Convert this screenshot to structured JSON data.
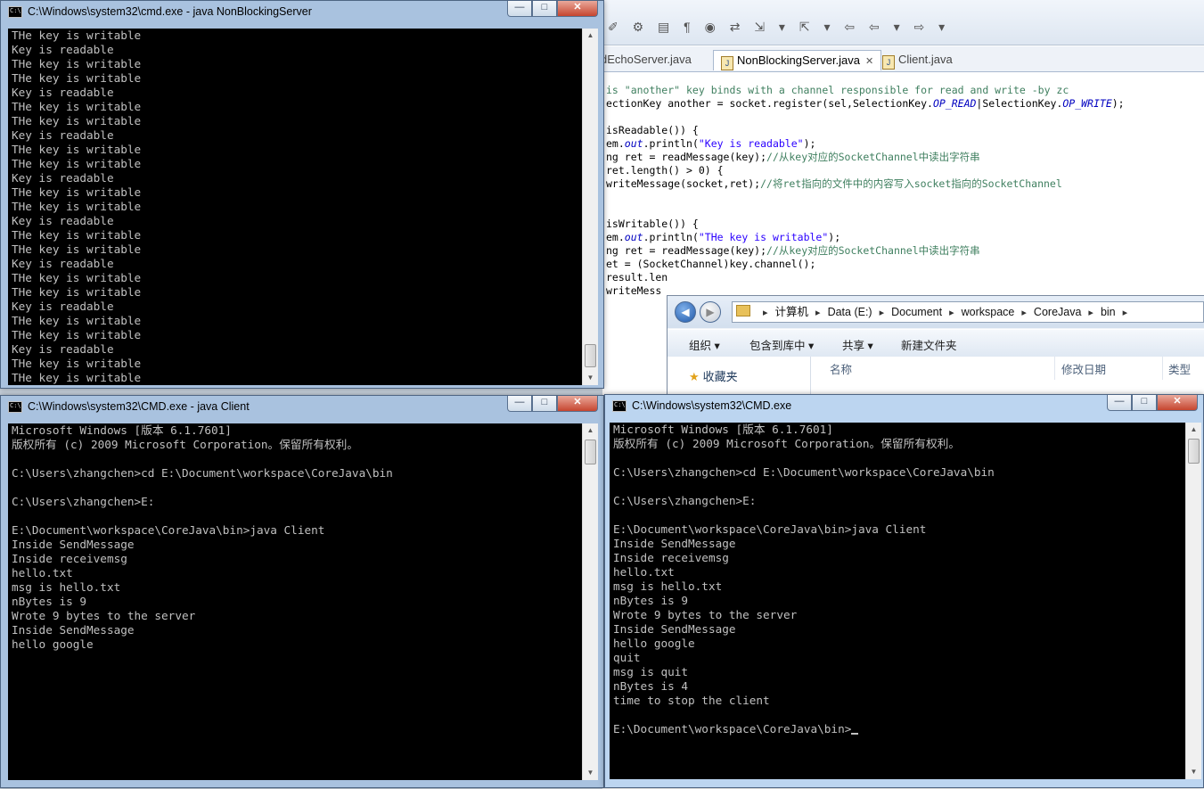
{
  "eclipse": {
    "tabs": [
      {
        "label": "dEchoServer.java"
      },
      {
        "label": "NonBlockingServer.java"
      },
      {
        "label": "Client.java"
      }
    ],
    "code_lines": [
      [
        {
          "t": "is \"another\" key binds with a channel responsible for read and write -by zc",
          "c": "cmt"
        }
      ],
      [
        {
          "t": "ectionKey another = socket.register(sel,SelectionKey.",
          "c": ""
        },
        {
          "t": "OP_READ",
          "c": "fld"
        },
        {
          "t": "|SelectionKey.",
          "c": ""
        },
        {
          "t": "OP_WRITE",
          "c": "fld"
        },
        {
          "t": ");",
          "c": ""
        }
      ],
      [
        {
          "t": "",
          "c": ""
        }
      ],
      [
        {
          "t": "isReadable()) {",
          "c": ""
        }
      ],
      [
        {
          "t": "em.",
          "c": ""
        },
        {
          "t": "out",
          "c": "fld"
        },
        {
          "t": ".println(",
          "c": ""
        },
        {
          "t": "\"Key is readable\"",
          "c": "str"
        },
        {
          "t": ");",
          "c": ""
        }
      ],
      [
        {
          "t": "ng ret = readMessage(key);",
          "c": ""
        },
        {
          "t": "//从key对应的SocketChannel中读出字符串",
          "c": "cmt"
        }
      ],
      [
        {
          "t": "ret.length() > 0) {",
          "c": ""
        }
      ],
      [
        {
          "t": "writeMessage(socket,ret);",
          "c": ""
        },
        {
          "t": "//将ret指向的文件中的内容写入socket指向的SocketChannel",
          "c": "cmt"
        }
      ],
      [
        {
          "t": "",
          "c": ""
        }
      ],
      [
        {
          "t": "",
          "c": ""
        }
      ],
      [
        {
          "t": "isWritable()) {",
          "c": ""
        }
      ],
      [
        {
          "t": "em.",
          "c": ""
        },
        {
          "t": "out",
          "c": "fld"
        },
        {
          "t": ".println(",
          "c": ""
        },
        {
          "t": "\"THe key is writable\"",
          "c": "str"
        },
        {
          "t": ");",
          "c": ""
        }
      ],
      [
        {
          "t": "ng ret = readMessage(key);",
          "c": ""
        },
        {
          "t": "//从key对应的SocketChannel中读出字符串",
          "c": "cmt"
        }
      ],
      [
        {
          "t": "et = (SocketChannel)key.channel();",
          "c": ""
        }
      ],
      [
        {
          "t": "result.len",
          "c": ""
        }
      ],
      [
        {
          "t": "writeMess",
          "c": ""
        }
      ]
    ]
  },
  "explorer": {
    "breadcrumb": [
      "计算机",
      "Data (E:)",
      "Document",
      "workspace",
      "CoreJava",
      "bin"
    ],
    "toolbar": [
      "组织 ▾",
      "包含到库中 ▾",
      "共享 ▾",
      "新建文件夹"
    ],
    "nav_favorites": "收藏夹",
    "columns": [
      "名称",
      "修改日期",
      "类型"
    ]
  },
  "server_window": {
    "title": "C:\\Windows\\system32\\cmd.exe - java  NonBlockingServer",
    "lines": [
      "THe key is writable",
      "Key is readable",
      "THe key is writable",
      "THe key is writable",
      "Key is readable",
      "THe key is writable",
      "THe key is writable",
      "Key is readable",
      "THe key is writable",
      "THe key is writable",
      "Key is readable",
      "THe key is writable",
      "THe key is writable",
      "Key is readable",
      "THe key is writable",
      "THe key is writable",
      "Key is readable",
      "THe key is writable",
      "THe key is writable",
      "Key is readable",
      "THe key is writable",
      "THe key is writable",
      "Key is readable",
      "THe key is writable",
      "THe key is writable"
    ]
  },
  "client1_window": {
    "title": "C:\\Windows\\system32\\CMD.exe - java  Client",
    "lines": [
      "Microsoft Windows [版本 6.1.7601]",
      "版权所有 (c) 2009 Microsoft Corporation。保留所有权利。",
      "",
      "C:\\Users\\zhangchen>cd E:\\Document\\workspace\\CoreJava\\bin",
      "",
      "C:\\Users\\zhangchen>E:",
      "",
      "E:\\Document\\workspace\\CoreJava\\bin>java Client",
      "Inside SendMessage",
      "Inside receivemsg",
      "hello.txt",
      "msg is hello.txt",
      "nBytes is 9",
      "Wrote 9 bytes to the server",
      "Inside SendMessage",
      "hello google"
    ]
  },
  "client2_window": {
    "title": "C:\\Windows\\system32\\CMD.exe",
    "lines": [
      "Microsoft Windows [版本 6.1.7601]",
      "版权所有 (c) 2009 Microsoft Corporation。保留所有权利。",
      "",
      "C:\\Users\\zhangchen>cd E:\\Document\\workspace\\CoreJava\\bin",
      "",
      "C:\\Users\\zhangchen>E:",
      "",
      "E:\\Document\\workspace\\CoreJava\\bin>java Client",
      "Inside SendMessage",
      "Inside receivemsg",
      "hello.txt",
      "msg is hello.txt",
      "nBytes is 9",
      "Wrote 9 bytes to the server",
      "Inside SendMessage",
      "hello google",
      "quit",
      "msg is quit",
      "nBytes is 4",
      "time to stop the client",
      "",
      "E:\\Document\\workspace\\CoreJava\\bin>"
    ]
  },
  "window_controls": {
    "minimize": "—",
    "maximize": "□",
    "close": "✕"
  }
}
